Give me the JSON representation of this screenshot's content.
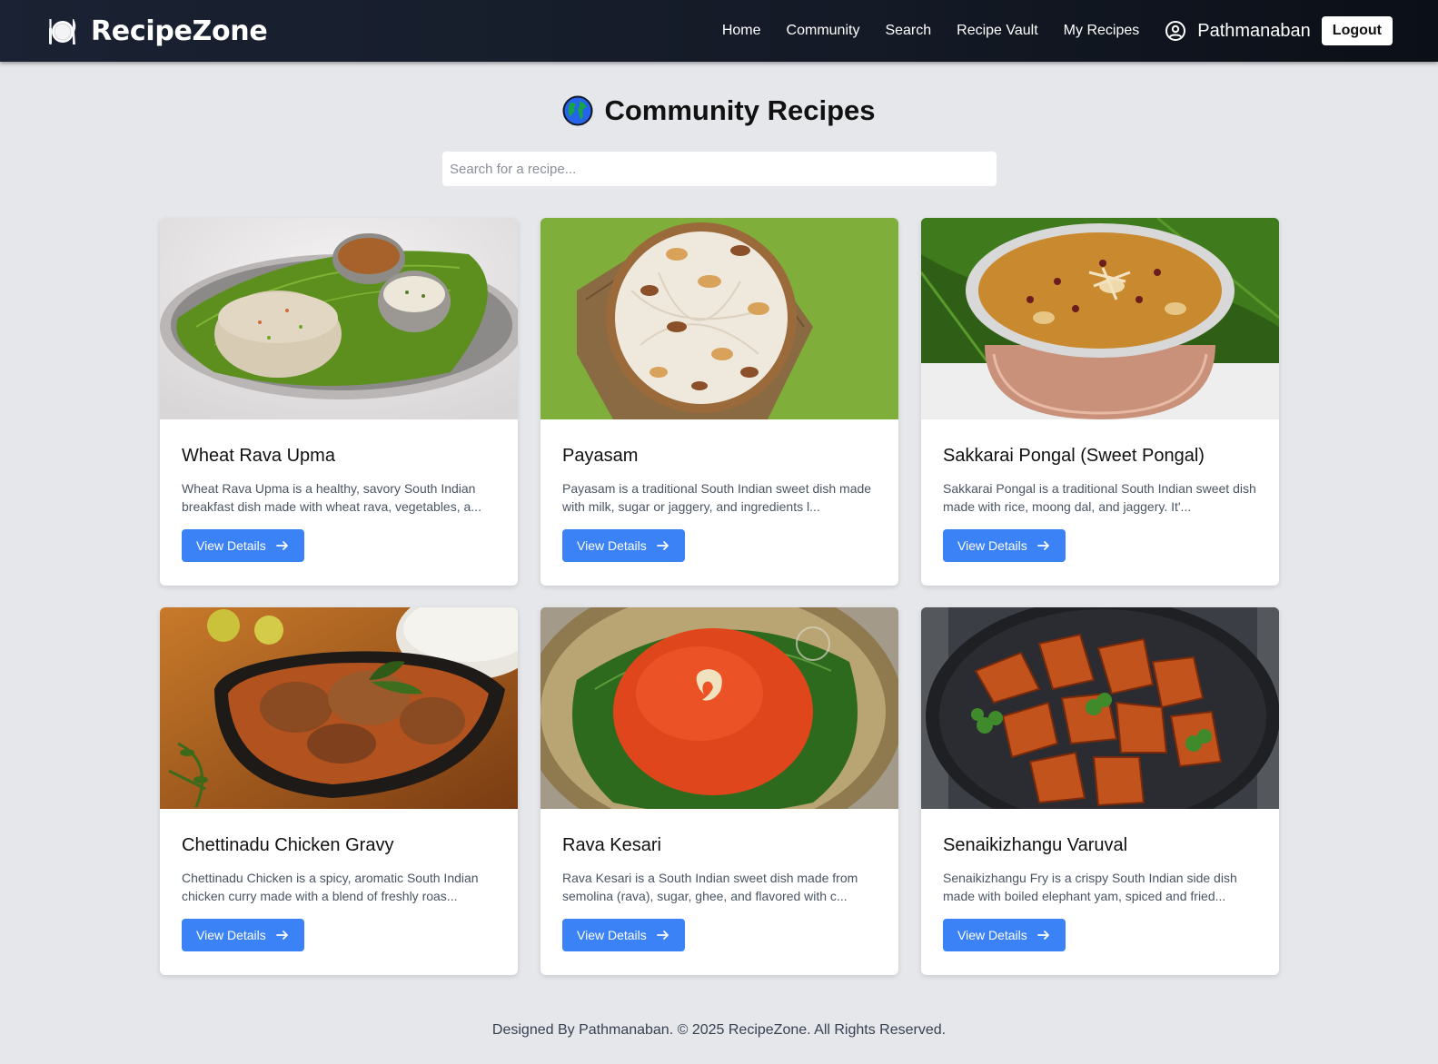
{
  "brand": {
    "name": "RecipeZone",
    "icon": "plate-cutlery-icon"
  },
  "nav": {
    "links": [
      "Home",
      "Community",
      "Search",
      "Recipe Vault",
      "My Recipes"
    ],
    "user_name": "Pathmanaban",
    "user_icon": "user-circle-icon",
    "logout_label": "Logout"
  },
  "page": {
    "title": "Community Recipes",
    "title_icon": "globe-icon",
    "search_placeholder": "Search for a recipe..."
  },
  "recipes": [
    {
      "title": "Wheat Rava Upma",
      "description": "Wheat Rava Upma is a healthy, savory South Indian breakfast dish made with wheat rava, vegetables, a...",
      "button_label": "View Details",
      "image": "upma-on-banana-leaf"
    },
    {
      "title": "Payasam",
      "description": "Payasam is a traditional South Indian sweet dish made with milk, sugar or jaggery, and ingredients l...",
      "button_label": "View Details",
      "image": "payasam-bowl-with-nuts"
    },
    {
      "title": "Sakkarai Pongal (Sweet Pongal)",
      "description": "Sakkarai Pongal is a traditional South Indian sweet dish made with rice, moong dal, and jaggery. It'...",
      "button_label": "View Details",
      "image": "sweet-pongal-in-copper-pot"
    },
    {
      "title": "Chettinadu Chicken Gravy",
      "description": "Chettinadu Chicken is a spicy, aromatic South Indian chicken curry made with a blend of freshly roas...",
      "button_label": "View Details",
      "image": "chicken-curry-in-pan"
    },
    {
      "title": "Rava Kesari",
      "description": "Rava Kesari is a South Indian sweet dish made from semolina (rava), sugar, ghee, and flavored with c...",
      "button_label": "View Details",
      "image": "rava-kesari-with-cashew"
    },
    {
      "title": "Senaikizhangu Varuval",
      "description": "Senaikizhangu Fry is a crispy South Indian side dish made with boiled elephant yam, spiced and fried...",
      "button_label": "View Details",
      "image": "fried-yam-pieces"
    }
  ],
  "footer": {
    "text": "Designed By Pathmanaban. © 2025 RecipeZone. All Rights Reserved."
  },
  "colors": {
    "accent": "#3b82f6",
    "navbar": "#141a26",
    "background": "#e5e7eb"
  }
}
